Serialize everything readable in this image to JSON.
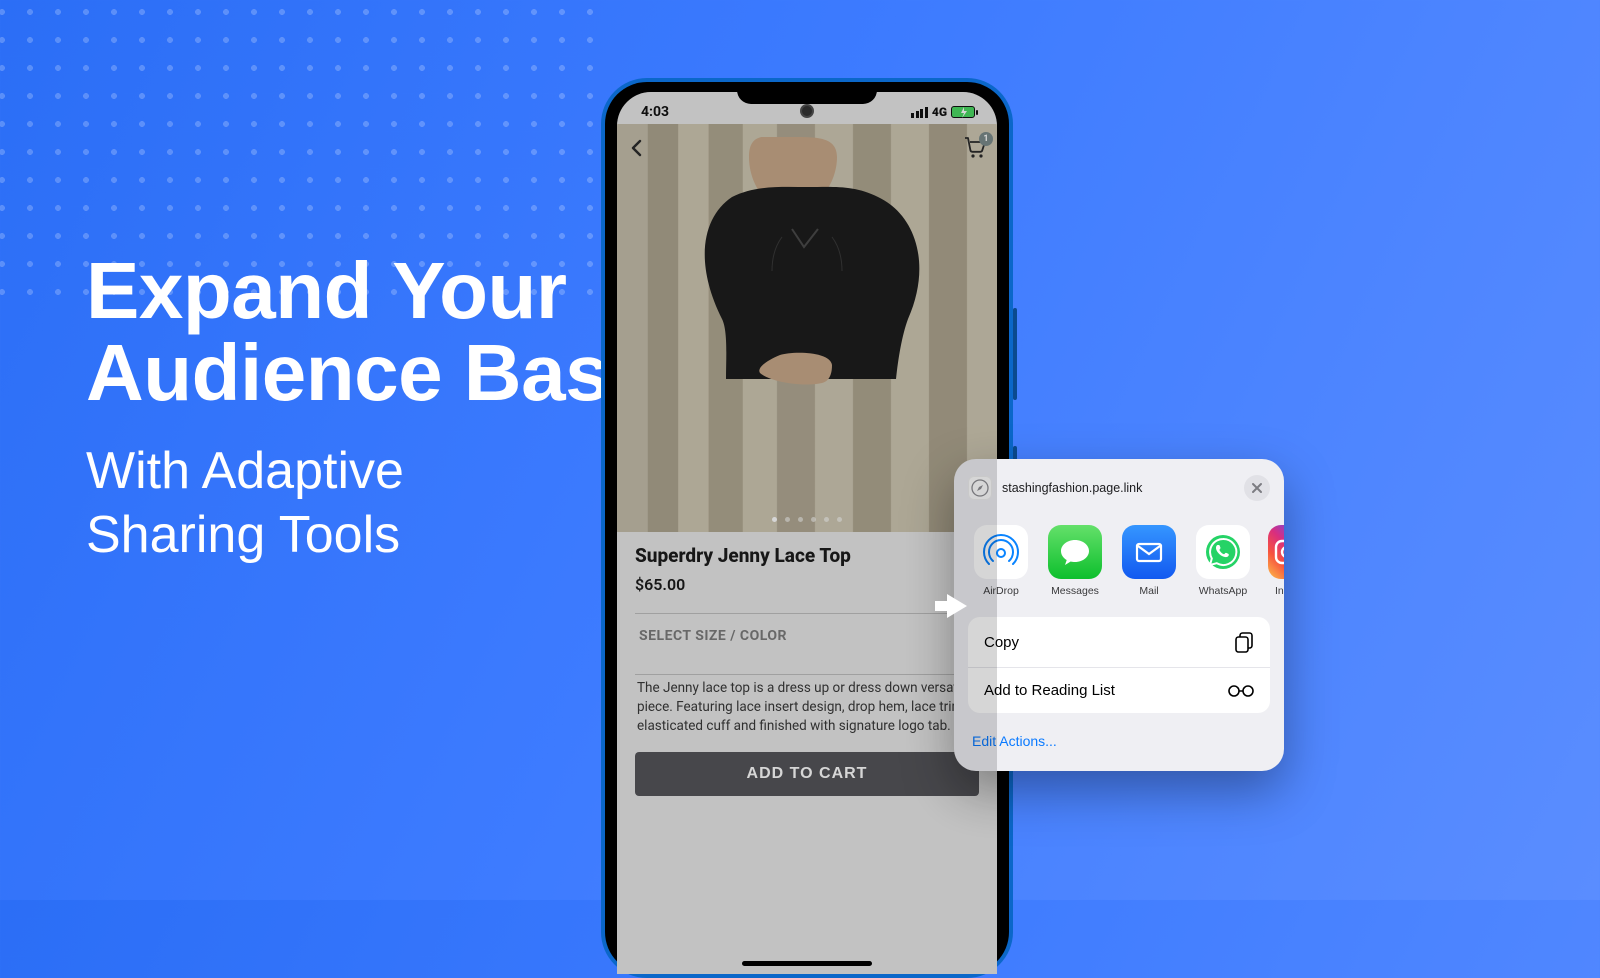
{
  "hero": {
    "title_l1": "Expand Your",
    "title_l2": "Audience Base",
    "sub_l1": "With Adaptive",
    "sub_l2": "Sharing Tools"
  },
  "phone": {
    "time": "4:03",
    "network": "4G",
    "cart_count": "1",
    "product": {
      "title": "Superdry Jenny Lace Top",
      "price": "$65.00",
      "size_label": "SELECT SIZE / COLOR",
      "desc": "The Jenny lace top is a dress up or dress down versatile piece. Featuring lace insert design, drop hem, lace trims, elasticated cuff and finished with signature logo tab.",
      "cta": "ADD TO CART"
    }
  },
  "sheet": {
    "url": "stashingfashion.page.link",
    "apps": [
      {
        "name": "AirDrop"
      },
      {
        "name": "Messages"
      },
      {
        "name": "Mail"
      },
      {
        "name": "WhatsApp"
      },
      {
        "name": "Ins"
      }
    ],
    "actions": {
      "copy": "Copy",
      "reading": "Add to Reading List"
    },
    "edit": "Edit Actions..."
  }
}
